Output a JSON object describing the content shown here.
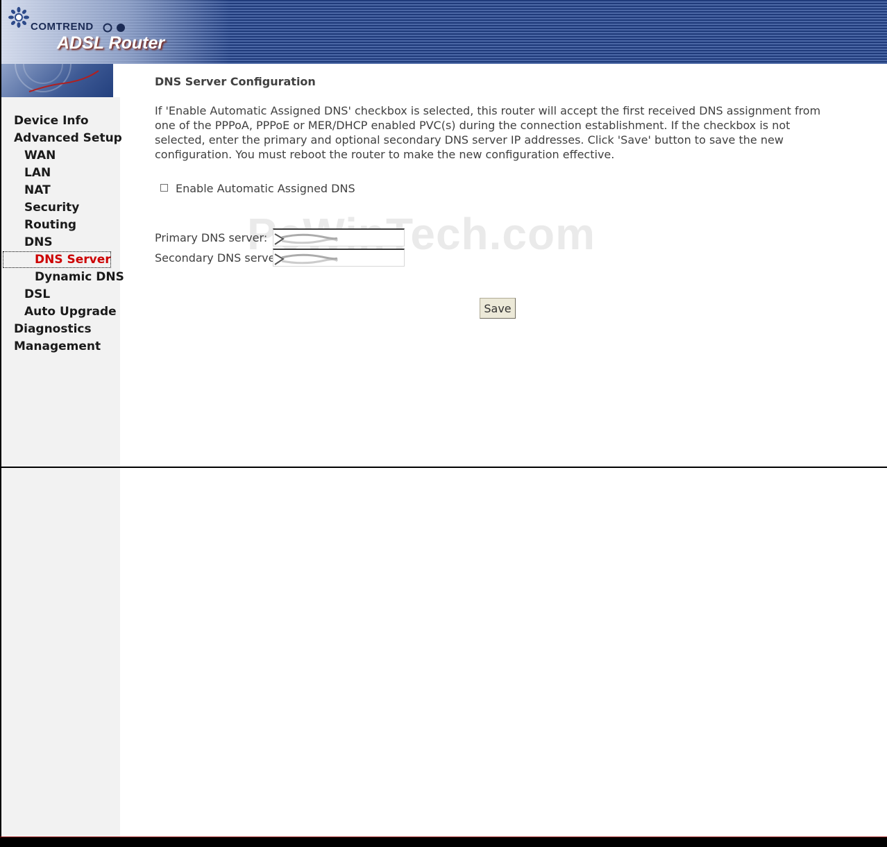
{
  "header": {
    "brand_name": "COMTREND",
    "product_name": "ADSL Router",
    "logo_icon": "sunflower-logo-icon"
  },
  "sidebar": {
    "items": [
      {
        "label": "Device Info",
        "level": 0
      },
      {
        "label": "Advanced Setup",
        "level": 0
      },
      {
        "label": "WAN",
        "level": 1
      },
      {
        "label": "LAN",
        "level": 1
      },
      {
        "label": "NAT",
        "level": 1
      },
      {
        "label": "Security",
        "level": 1
      },
      {
        "label": "Routing",
        "level": 1
      },
      {
        "label": "DNS",
        "level": 1
      },
      {
        "label": "DNS Server",
        "level": 2,
        "active": true
      },
      {
        "label": "Dynamic DNS",
        "level": 2
      },
      {
        "label": "DSL",
        "level": 1
      },
      {
        "label": "Auto Upgrade",
        "level": 1
      },
      {
        "label": "Diagnostics",
        "level": 0
      },
      {
        "label": "Management",
        "level": 0
      }
    ],
    "active_color": "#cc0000"
  },
  "main": {
    "title": "DNS Server Configuration",
    "intro": "If 'Enable Automatic Assigned DNS' checkbox is selected, this router will accept the first received DNS assignment from one of the PPPoA, PPPoE or MER/DHCP enabled PVC(s) during the connection establishment. If the checkbox is not selected, enter the primary and optional secondary DNS server IP addresses. Click 'Save' button to save the new configuration. You must reboot the router to make the new configuration effective.",
    "auto_dns": {
      "label": "Enable Automatic Assigned DNS",
      "checked": false
    },
    "primary_dns": {
      "label": "Primary DNS server:",
      "value": ""
    },
    "secondary_dns": {
      "label": "Secondary DNS server:",
      "value": ""
    },
    "save_label": "Save"
  },
  "watermark": "PcWinTech.com"
}
